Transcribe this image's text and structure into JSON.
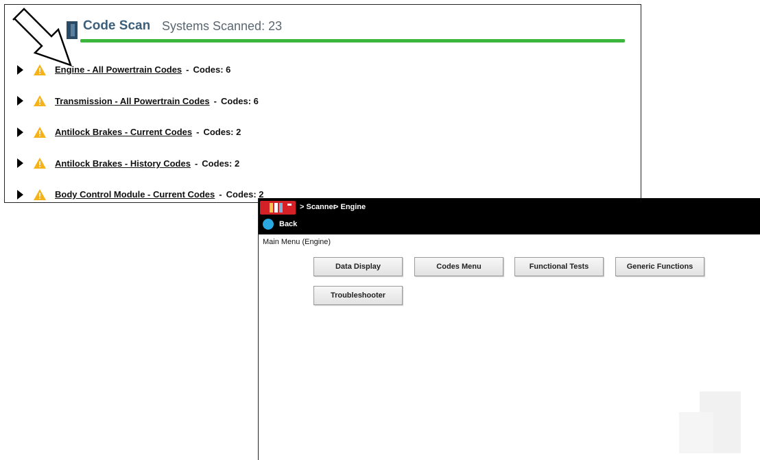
{
  "scan": {
    "title": "Code Scan",
    "systems_scanned": "Systems Scanned: 23",
    "progress": 1.0,
    "progress_color": "#3cb63c",
    "rows": [
      {
        "label": "Engine - All Powertrain Codes",
        "separator": "-",
        "codes": "Codes: 6"
      },
      {
        "label": "Transmission - All Powertrain Codes",
        "separator": "-",
        "codes": "Codes: 6"
      },
      {
        "label": "Antilock Brakes - Current Codes",
        "separator": "-",
        "codes": "Codes: 2"
      },
      {
        "label": "Antilock Brakes - History Codes",
        "separator": "-",
        "codes": "Codes: 2"
      },
      {
        "label": "Body Control Module - Current Codes",
        "separator": "-",
        "codes": "Codes: 2"
      }
    ]
  },
  "engine": {
    "breadcrumb": [
      "> Scanner",
      "> Engine"
    ],
    "back_label": "Back",
    "menu_title": "Main Menu (Engine)",
    "buttons": [
      "Data Display",
      "Codes Menu",
      "Functional Tests",
      "Generic Functions",
      "Troubleshooter"
    ]
  },
  "colors": {
    "title": "#3b5f7a",
    "warning": "#f5b21a",
    "topbar": "#000000",
    "brand": "#d62028",
    "back": "#2aa9e0"
  }
}
